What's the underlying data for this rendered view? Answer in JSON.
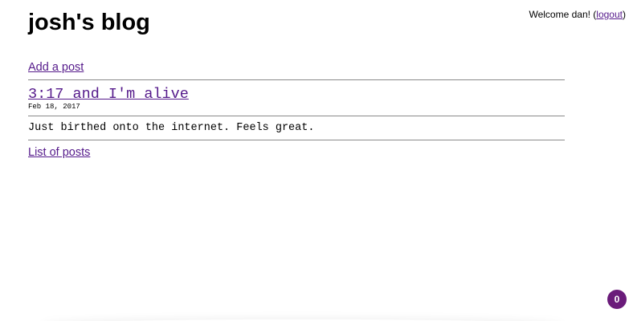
{
  "header": {
    "blog_title": "josh's blog",
    "welcome_prefix": "Welcome dan! (",
    "logout_label": "logout",
    "welcome_suffix": ")"
  },
  "nav": {
    "add_post_label": "Add a post",
    "list_posts_label": "List of posts"
  },
  "post": {
    "title": "3:17 and I'm alive",
    "date": "Feb 18, 2017",
    "body": "Just birthed onto the internet. Feels great."
  },
  "badge": {
    "count": "0",
    "color": "#6a1b7a"
  },
  "colors": {
    "link": "#551a8b",
    "rule": "#8a8a8a"
  }
}
